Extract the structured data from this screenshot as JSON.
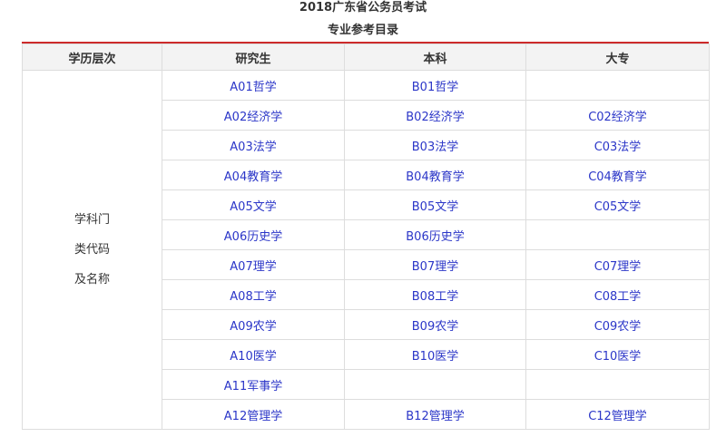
{
  "page": {
    "title": "2018广东省公务员考试",
    "caption": "专业参考目录"
  },
  "table": {
    "headers": [
      "学历层次",
      "研究生",
      "本科",
      "大专"
    ],
    "row_label_lines": [
      "学科门",
      "类代码",
      "及名称"
    ],
    "rows": [
      [
        "A01哲学",
        "B01哲学",
        ""
      ],
      [
        "A02经济学",
        "B02经济学",
        "C02经济学"
      ],
      [
        "A03法学",
        "B03法学",
        "C03法学"
      ],
      [
        "A04教育学",
        "B04教育学",
        "C04教育学"
      ],
      [
        "A05文学",
        "B05文学",
        "C05文学"
      ],
      [
        "A06历史学",
        "B06历史学",
        ""
      ],
      [
        "A07理学",
        "B07理学",
        "C07理学"
      ],
      [
        "A08工学",
        "B08工学",
        "C08工学"
      ],
      [
        "A09农学",
        "B09农学",
        "C09农学"
      ],
      [
        "A10医学",
        "B10医学",
        "C10医学"
      ],
      [
        "A11军事学",
        "",
        ""
      ],
      [
        "A12管理学",
        "B12管理学",
        "C12管理学"
      ]
    ]
  },
  "colors": {
    "link_blue": "#2b36c8",
    "accent_red": "#cc2a2a",
    "header_bg": "#f3f3f3",
    "border": "#dddddd"
  }
}
